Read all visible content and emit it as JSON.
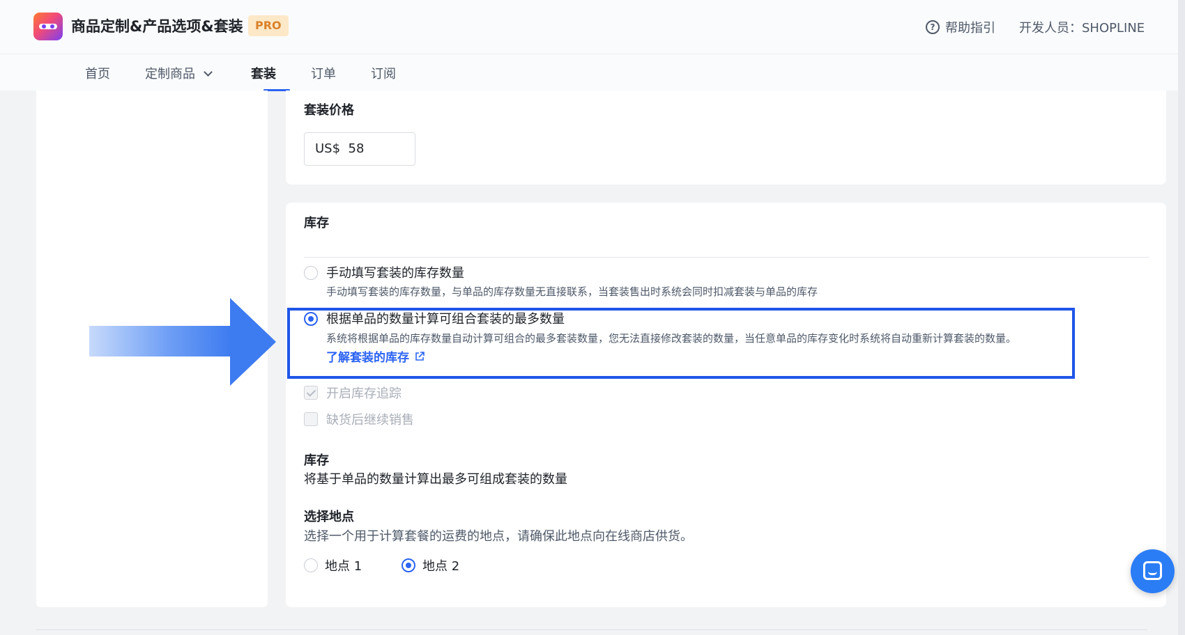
{
  "header": {
    "app_title": "商品定制&产品选项&套装",
    "badge": "PRO",
    "help_label": "帮助指引",
    "help_icon": "question-circle-icon",
    "developer": "开发人员：SHOPLINE"
  },
  "nav": {
    "items": [
      "首页",
      "定制商品",
      "套装",
      "订单",
      "订阅"
    ],
    "active_index": 2
  },
  "bundle_price": {
    "label": "套装价格",
    "currency": "US$",
    "value": "58"
  },
  "inventory": {
    "section_title": "库存",
    "options": [
      {
        "title": "手动填写套装的库存数量",
        "description": "手动填写套装的库存数量，与单品的库存数量无直接联系，当套装售出时系统会同时扣减套装与单品的库存",
        "selected": false
      },
      {
        "title": "根据单品的数量计算可组合套装的最多数量",
        "description": "系统将根据单品的库存数量自动计算可组合的最多套装数量，您无法直接修改套装的数量，当任意单品的库存变化时系统将自动重新计算套装的数量。",
        "link": "了解套装的库存",
        "selected": true
      }
    ],
    "track_inventory": {
      "label": "开启库存追踪",
      "checked": true,
      "disabled": true
    },
    "continue_selling": {
      "label": "缺货后继续销售",
      "checked": false,
      "disabled": true
    },
    "stock_title": "库存",
    "stock_desc": "将基于单品的数量计算出最多可组成套装的数量",
    "location_title": "选择地点",
    "location_desc": "选择一个用于计算套餐的运费的地点，请确保此地点向在线商店供货。",
    "locations": [
      {
        "label": "地点 1",
        "selected": false
      },
      {
        "label": "地点 2",
        "selected": true
      }
    ]
  },
  "colors": {
    "accent": "#2b63f2",
    "highlight_border": "#1f55e8",
    "pro_badge_bg": "#fde8c8",
    "pro_badge_text": "#d9822b"
  }
}
